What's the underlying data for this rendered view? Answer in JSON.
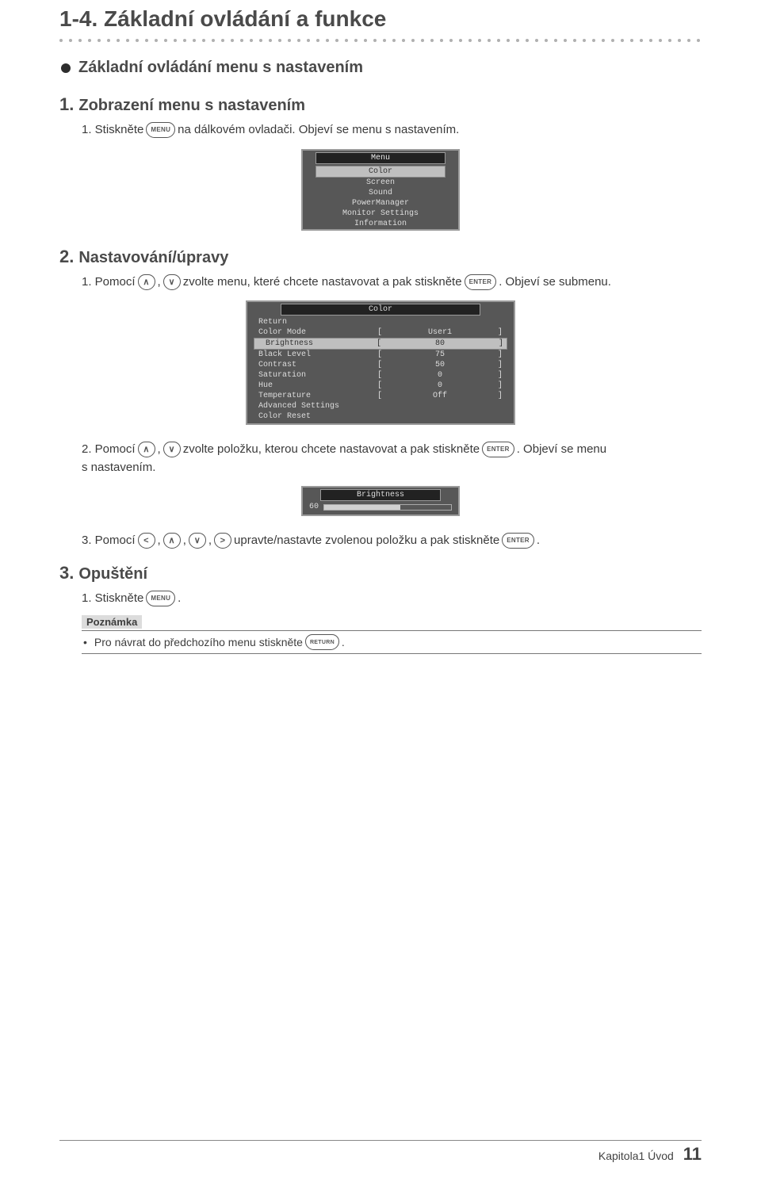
{
  "section_title": "1-4.  Základní ovládání a funkce",
  "bullet_title": "Základní ovládání menu s nastavením",
  "steps": {
    "s1": {
      "num": "1.",
      "title": "Zobrazení menu s nastavením",
      "i1_lead": "1.  Stiskněte ",
      "i1_btn": "MENU",
      "i1_tail": " na dálkovém ovladači. Objeví se menu s nastavením."
    },
    "s2": {
      "num": "2.",
      "title": "Nastavování/úpravy",
      "i1_lead": "1.  Pomocí ",
      "i1_mid": " zvolte menu, které chcete nastavovat a pak stiskněte ",
      "i1_enter": "ENTER",
      "i1_tail": ". Objeví se submenu.",
      "i2_lead": "2.  Pomocí ",
      "i2_mid": " zvolte položku, kterou chcete nastavovat a pak stiskněte ",
      "i2_tail1": ". Objeví se menu",
      "i2_tail2": "s nastavením.",
      "i3_lead": "3.  Pomocí ",
      "i3_mid": " upravte/nastavte zvolenou položku a pak stiskněte ",
      "i3_tail": "."
    },
    "s3": {
      "num": "3.",
      "title": "Opuštění",
      "i1_lead": "1.  Stiskněte ",
      "i1_btn": "MENU",
      "i1_tail": "."
    }
  },
  "note": {
    "label": "Poznámka",
    "bullet": "•",
    "text_lead": "Pro návrat do předchozího menu stiskněte ",
    "btn": "RETURN",
    "text_tail": "."
  },
  "osd_menu1": {
    "title": "Menu",
    "items": [
      "Color",
      "Screen",
      "Sound",
      "PowerManager",
      "Monitor Settings",
      "Information"
    ],
    "selected_index": 0
  },
  "osd_menu2": {
    "title": "Color",
    "return_label": "Return",
    "rows": [
      {
        "label": "Color Mode",
        "value": "User1"
      },
      {
        "label": "Brightness",
        "value": "80"
      },
      {
        "label": "Black Level",
        "value": "75"
      },
      {
        "label": "Contrast",
        "value": "50"
      },
      {
        "label": "Saturation",
        "value": "0"
      },
      {
        "label": "Hue",
        "value": "0"
      },
      {
        "label": "Temperature",
        "value": "Off"
      },
      {
        "label": "Advanced Settings",
        "value": ""
      },
      {
        "label": "Color Reset",
        "value": ""
      }
    ],
    "selected_index": 1
  },
  "osd_menu3": {
    "title": "Brightness",
    "value": "60",
    "fill_percent": 60
  },
  "arrows": {
    "up": "∧",
    "down": "∨",
    "left": "<",
    "right": ">",
    "comma": ", "
  },
  "footer": {
    "chapter": "Kapitola1 Úvod",
    "page": "11"
  }
}
